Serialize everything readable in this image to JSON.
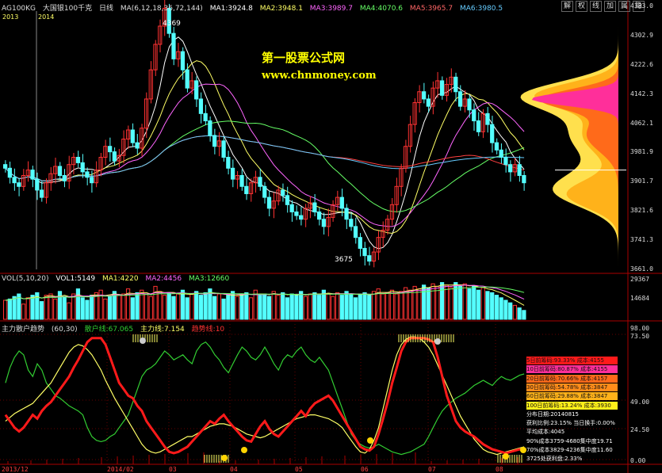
{
  "header": {
    "symbol": "AG100KG",
    "name": "大国银100千克",
    "period": "日线",
    "ma_params": "MA(6,12,18,36,72,144)",
    "ma1": "MA1:3924.8",
    "ma2": "MA2:3948.1",
    "ma3": "MA3:3989.7",
    "ma4": "MA4:4070.6",
    "ma5": "MA5:3965.7",
    "ma6": "MA6:3980.5"
  },
  "right_buttons": [
    "解",
    "权",
    "线",
    "加",
    "属",
    "隐"
  ],
  "year_labels": [
    "2013",
    "2014"
  ],
  "price_axis": [
    "4383.0",
    "4302.9",
    "4222.6",
    "4142.3",
    "4062.1",
    "3981.9",
    "3901.7",
    "3821.6",
    "3741.3",
    "3661.0"
  ],
  "annotations": {
    "high": "4369",
    "low": "3675"
  },
  "watermark": {
    "title": "第一股票公式网",
    "url": "www.chnmoney.com"
  },
  "volume_header": {
    "params": "VOL(5,10,20)",
    "vol": "VOL1:5149",
    "ma1": "MA1:4220",
    "ma2": "MA2:4456",
    "ma3": "MA3:12660"
  },
  "volume_axis": [
    "29367",
    "14684"
  ],
  "indicator_header": {
    "name": "主力散户趋势",
    "params": "(60,30)",
    "retail": "散户线:67.065",
    "main": "主力线:7.154",
    "trend": "趋势线:10"
  },
  "indicator_axis": [
    "98.00",
    "73.50",
    "49.00",
    "24.50",
    "0.00"
  ],
  "time_axis": [
    "2013/12",
    "2014/02",
    "03",
    "04",
    "05",
    "06",
    "07",
    "08"
  ],
  "cost_stats": [
    {
      "label": "5日前筹码:93.33%  成本:4155",
      "color": "#ff1a1a"
    },
    {
      "label": "10日前筹码:80.87%  成本:4155",
      "color": "#ff2f9a"
    },
    {
      "label": "20日前筹码:70.66%  成本:4157",
      "color": "#ff6a1a"
    },
    {
      "label": "30日前筹码:54.78%  成本:3847",
      "color": "#ff8c1a"
    },
    {
      "label": "60日前筹码:29.88%  成本:3847",
      "color": "#ffb21a"
    },
    {
      "label": "100日前筹码:13.24%  成本:3930",
      "color": "#ffef1a"
    }
  ],
  "distribution_info": [
    "分布日期:20140815",
    "获利比例:23.15%  当日换手:0.00%",
    "平均成本:4045",
    "90%成本3759-4680集中度19.71",
    "70%成本3829-4236集中度11.60",
    "3725处获利盘:2.33%"
  ],
  "colors": {
    "up": "#ff3232",
    "down": "#54ffff",
    "retail_line": "#32cd32",
    "main_line": "#ff1a1a",
    "trend_line": "#ffff66",
    "watermark_title": "#ffff00",
    "watermark_url": "#ffff00"
  },
  "chart_data": {
    "type": "candlestick",
    "price_range": [
      3661.0,
      4383.0
    ],
    "close_series": [
      3930,
      3905,
      3890,
      3880,
      3910,
      3925,
      3900,
      3870,
      3850,
      3890,
      3915,
      3935,
      3910,
      3895,
      3940,
      3960,
      3945,
      3920,
      3905,
      3890,
      3925,
      3960,
      3990,
      3975,
      3950,
      3965,
      4010,
      4035,
      4000,
      3985,
      4040,
      4120,
      4200,
      4270,
      4320,
      4369,
      4300,
      4230,
      4250,
      4200,
      4150,
      4170,
      4120,
      4080,
      4060,
      4020,
      3990,
      4005,
      3960,
      3930,
      3900,
      3910,
      3880,
      3860,
      3890,
      3905,
      3880,
      3850,
      3820,
      3840,
      3870,
      3855,
      3830,
      3810,
      3800,
      3790,
      3820,
      3835,
      3810,
      3790,
      3770,
      3795,
      3830,
      3850,
      3820,
      3790,
      3770,
      3740,
      3710,
      3690,
      3675,
      3700,
      3740,
      3760,
      3790,
      3830,
      3880,
      3930,
      3990,
      4050,
      4110,
      4140,
      4120,
      4100,
      4150,
      4170,
      4130,
      4160,
      4180,
      4140,
      4100,
      4120,
      4090,
      4060,
      4030,
      4080,
      4050,
      4000,
      3980,
      3960,
      3940,
      3920,
      3940,
      3910,
      3890
    ],
    "volume_series": [
      1.5,
      1.6,
      1.8,
      2.0,
      1.2,
      1.7,
      1.9,
      2.1,
      1.4,
      1.9,
      2.0,
      1.6,
      2.2,
      1.8,
      1.3,
      2.0,
      2.4,
      1.7,
      1.5,
      1.9,
      2.1,
      2.3,
      1.6,
      1.8,
      2.2,
      1.9,
      2.0,
      2.4,
      1.7,
      2.1,
      2.3,
      2.0,
      1.8,
      2.6,
      2.2,
      1.9,
      2.1,
      1.8,
      2.0,
      2.3,
      1.7,
      2.0,
      2.2,
      1.9,
      2.1,
      2.4,
      1.8,
      2.0,
      1.6,
      1.9,
      2.2,
      1.8,
      2.0,
      2.1,
      1.7,
      2.3,
      1.9,
      2.0,
      1.8,
      2.2,
      1.9,
      2.1,
      1.7,
      2.0,
      1.9,
      2.2,
      1.8,
      2.0,
      2.1,
      1.9,
      2.3,
      2.0,
      1.8,
      2.1,
      1.9,
      2.2,
      2.0,
      1.7,
      2.0,
      2.1,
      1.9,
      2.2,
      2.4,
      2.0,
      2.1,
      2.3,
      2.0,
      2.2,
      2.5,
      2.3,
      2.6,
      2.4,
      2.7,
      2.5,
      2.8,
      2.6,
      2.9,
      2.7,
      2.5,
      2.9,
      2.6,
      2.8,
      2.4,
      2.6,
      2.3,
      2.5,
      2.2,
      2.1,
      1.9,
      1.7,
      1.5,
      1.3,
      1.1,
      0.9,
      0.7
    ],
    "retail_series": [
      60,
      72,
      80,
      85,
      82,
      70,
      65,
      75,
      70,
      60,
      55,
      50,
      48,
      45,
      42,
      40,
      38,
      35,
      25,
      18,
      15,
      14,
      15,
      18,
      20,
      25,
      30,
      35,
      45,
      55,
      65,
      70,
      72,
      75,
      80,
      85,
      82,
      78,
      80,
      82,
      78,
      75,
      85,
      90,
      92,
      88,
      82,
      78,
      72,
      68,
      75,
      82,
      88,
      85,
      80,
      78,
      82,
      88,
      82,
      75,
      70,
      78,
      82,
      80,
      85,
      88,
      82,
      78,
      76,
      80,
      75,
      70,
      60,
      50,
      40,
      30,
      20,
      15,
      12,
      10,
      9,
      10,
      12,
      10,
      8,
      6,
      5,
      4,
      5,
      6,
      8,
      10,
      12,
      18,
      25,
      32,
      38,
      42,
      45,
      48,
      50,
      52,
      55,
      58,
      60,
      62,
      60,
      58,
      62,
      65,
      63,
      62,
      64,
      66,
      67
    ],
    "main_series": [
      35,
      30,
      25,
      22,
      25,
      30,
      35,
      32,
      38,
      42,
      45,
      50,
      55,
      60,
      65,
      72,
      78,
      85,
      92,
      95,
      95,
      95,
      90,
      80,
      70,
      60,
      55,
      50,
      48,
      42,
      38,
      30,
      25,
      20,
      15,
      10,
      6,
      5,
      6,
      8,
      10,
      14,
      18,
      22,
      26,
      30,
      28,
      32,
      35,
      30,
      26,
      22,
      18,
      15,
      14,
      20,
      26,
      30,
      24,
      20,
      18,
      22,
      26,
      30,
      34,
      38,
      34,
      40,
      44,
      46,
      48,
      50,
      46,
      40,
      34,
      28,
      22,
      16,
      10,
      8,
      7,
      10,
      20,
      32,
      45,
      60,
      72,
      85,
      92,
      95,
      95,
      95,
      95,
      94,
      92,
      80,
      65,
      50,
      40,
      30,
      25,
      22,
      20,
      18,
      15,
      12,
      10,
      8,
      7,
      6,
      5,
      6,
      7,
      8,
      7
    ],
    "trend_series": [
      30,
      33,
      36,
      38,
      40,
      42,
      44,
      48,
      52,
      56,
      60,
      66,
      72,
      78,
      84,
      88,
      90,
      89,
      86,
      82,
      76,
      70,
      62,
      55,
      48,
      42,
      36,
      30,
      24,
      18,
      12,
      8,
      6,
      5,
      6,
      8,
      10,
      12,
      14,
      16,
      18,
      18,
      20,
      22,
      24,
      26,
      27,
      28,
      28,
      27,
      26,
      24,
      22,
      20,
      19,
      18,
      17,
      18,
      20,
      22,
      24,
      26,
      28,
      30,
      32,
      33,
      34,
      35,
      35,
      34,
      33,
      32,
      30,
      28,
      25,
      20,
      15,
      10,
      6,
      5,
      8,
      15,
      25,
      40,
      55,
      70,
      82,
      90,
      94,
      96,
      96,
      95,
      92,
      88,
      82,
      74,
      66,
      58,
      50,
      42,
      34,
      28,
      22,
      16,
      12,
      8,
      6,
      5,
      4,
      5,
      6,
      7,
      8,
      9,
      10
    ]
  }
}
